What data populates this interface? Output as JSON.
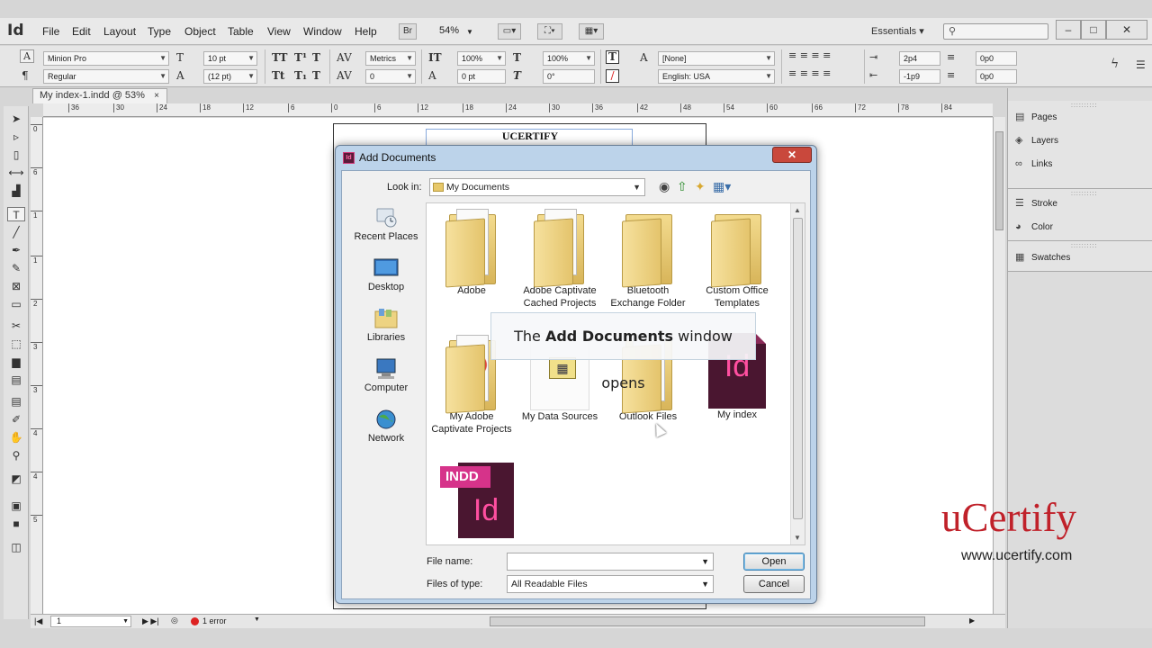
{
  "menubar": {
    "logo": "Id",
    "items": [
      "File",
      "Edit",
      "Layout",
      "Type",
      "Object",
      "Table",
      "View",
      "Window",
      "Help"
    ],
    "bridge": "Br",
    "zoom": "54%",
    "workspace": "Essentials",
    "window_buttons": [
      "–",
      "□",
      "✕"
    ]
  },
  "control": {
    "font_family": "Minion Pro",
    "font_style": "Regular",
    "font_size": "10 pt",
    "leading": "(12 pt)",
    "kerning": "Metrics",
    "tracking": "0",
    "vscale": "100%",
    "baseline": "0 pt",
    "hscale": "100%",
    "skew": "0°",
    "char_style": "[None]",
    "language": "English: USA",
    "indent_top": "2p4",
    "indent_bottom": "-1p9",
    "space_top": "0p0",
    "space_bottom": "0p0"
  },
  "tab": {
    "title": "My index-1.indd @ 53%",
    "close": "×"
  },
  "ruler": {
    "h_ticks": [
      "36",
      "30",
      "24",
      "18",
      "12",
      "6",
      "0",
      "6",
      "12",
      "18",
      "24",
      "30",
      "36",
      "42",
      "48",
      "54",
      "60",
      "66",
      "72",
      "78",
      "84"
    ],
    "v_ticks": [
      "0",
      "6",
      "1",
      "1",
      "2",
      "3",
      "3",
      "4",
      "4",
      "5"
    ]
  },
  "page": {
    "heading": "UCERTIFY"
  },
  "status": {
    "page": "1",
    "error": "1 error"
  },
  "panels": {
    "group1": [
      "Pages",
      "Layers",
      "Links"
    ],
    "group2": [
      "Stroke",
      "Color"
    ],
    "group3": [
      "Swatches"
    ]
  },
  "dialog": {
    "title": "Add Documents",
    "close": "✕",
    "lookin_label": "Look in:",
    "lookin_value": "My Documents",
    "places": [
      "Recent Places",
      "Desktop",
      "Libraries",
      "Computer",
      "Network"
    ],
    "files": [
      "Adobe",
      "Adobe Captivate Cached Projects",
      "Bluetooth Exchange Folder",
      "Custom Office Templates",
      "My Adobe Captivate Projects",
      "My Data Sources",
      "Outlook Files",
      "My index"
    ],
    "indd_tag": "INDD",
    "id_letters": "Id",
    "file_name_label": "File name:",
    "file_name_value": "",
    "file_type_label": "Files of type:",
    "file_type_value": "All Readable Files",
    "open": "Open",
    "cancel": "Cancel"
  },
  "caption": {
    "prefix": "The ",
    "bold": "Add Documents",
    "suffix": " window opens"
  },
  "watermark": {
    "logo": "uCertify",
    "url": "www.ucertify.com"
  },
  "colors": {
    "brand_red": "#c0212a",
    "indesign_pink": "#ff4fa0",
    "indesign_dark": "#4a1630"
  }
}
